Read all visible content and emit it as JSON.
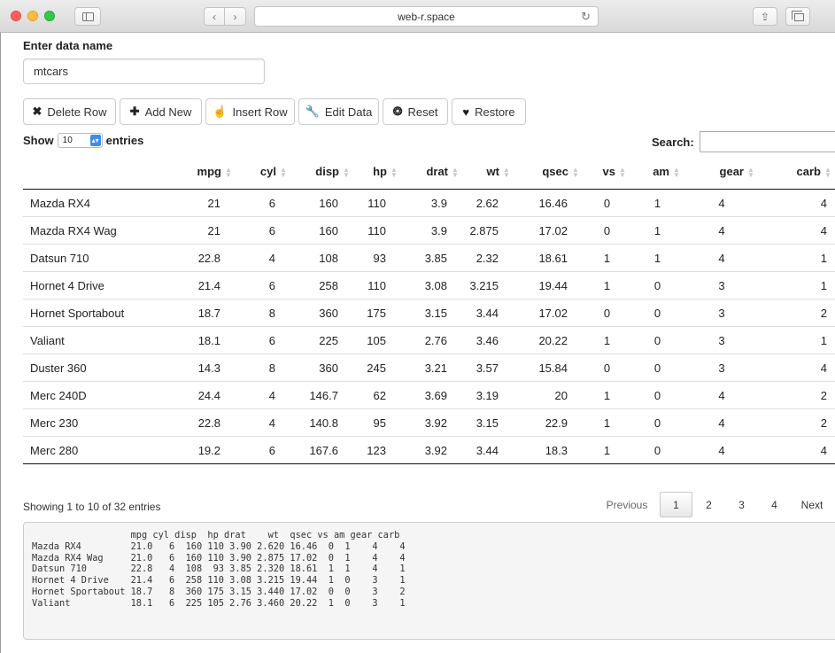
{
  "browser": {
    "address": "web-r.space",
    "back_icon": "chevron-left-icon",
    "forward_icon": "chevron-right-icon"
  },
  "form": {
    "label": "Enter data name",
    "value": "mtcars"
  },
  "toolbar": {
    "buttons": [
      {
        "label": "Delete Row",
        "icon": "✖"
      },
      {
        "label": "Add New",
        "icon": "✚"
      },
      {
        "label": "Insert Row",
        "icon": "☝"
      },
      {
        "label": "Edit Data",
        "icon": "🔧"
      },
      {
        "label": "Reset",
        "icon": "❂"
      },
      {
        "label": "Restore",
        "icon": "♥"
      }
    ]
  },
  "table": {
    "show_label": "Show",
    "entries_label": "entries",
    "page_length": "10",
    "search_label": "Search:",
    "search_value": "",
    "columns": [
      "",
      "mpg",
      "cyl",
      "disp",
      "hp",
      "drat",
      "wt",
      "qsec",
      "vs",
      "am",
      "gear",
      "carb"
    ],
    "rows": [
      [
        "Mazda RX4",
        "21",
        "6",
        "160",
        "110",
        "3.9",
        "2.62",
        "16.46",
        "0",
        "1",
        "4",
        "4"
      ],
      [
        "Mazda RX4 Wag",
        "21",
        "6",
        "160",
        "110",
        "3.9",
        "2.875",
        "17.02",
        "0",
        "1",
        "4",
        "4"
      ],
      [
        "Datsun 710",
        "22.8",
        "4",
        "108",
        "93",
        "3.85",
        "2.32",
        "18.61",
        "1",
        "1",
        "4",
        "1"
      ],
      [
        "Hornet 4 Drive",
        "21.4",
        "6",
        "258",
        "110",
        "3.08",
        "3.215",
        "19.44",
        "1",
        "0",
        "3",
        "1"
      ],
      [
        "Hornet Sportabout",
        "18.7",
        "8",
        "360",
        "175",
        "3.15",
        "3.44",
        "17.02",
        "0",
        "0",
        "3",
        "2"
      ],
      [
        "Valiant",
        "18.1",
        "6",
        "225",
        "105",
        "2.76",
        "3.46",
        "20.22",
        "1",
        "0",
        "3",
        "1"
      ],
      [
        "Duster 360",
        "14.3",
        "8",
        "360",
        "245",
        "3.21",
        "3.57",
        "15.84",
        "0",
        "0",
        "3",
        "4"
      ],
      [
        "Merc 240D",
        "24.4",
        "4",
        "146.7",
        "62",
        "3.69",
        "3.19",
        "20",
        "1",
        "0",
        "4",
        "2"
      ],
      [
        "Merc 230",
        "22.8",
        "4",
        "140.8",
        "95",
        "3.92",
        "3.15",
        "22.9",
        "1",
        "0",
        "4",
        "2"
      ],
      [
        "Merc 280",
        "19.2",
        "6",
        "167.6",
        "123",
        "3.92",
        "3.44",
        "18.3",
        "1",
        "0",
        "4",
        "4"
      ]
    ],
    "info": "Showing 1 to 10 of 32 entries",
    "pagination": {
      "previous": "Previous",
      "pages": [
        "1",
        "2",
        "3",
        "4"
      ],
      "current": "1",
      "next": "Next"
    }
  },
  "console": {
    "output": "                  mpg cyl disp  hp drat    wt  qsec vs am gear carb\nMazda RX4         21.0   6  160 110 3.90 2.620 16.46  0  1    4    4\nMazda RX4 Wag     21.0   6  160 110 3.90 2.875 17.02  0  1    4    4\nDatsun 710        22.8   4  108  93 3.85 2.320 18.61  1  1    4    1\nHornet 4 Drive    21.4   6  258 110 3.08 3.215 19.44  1  0    3    1\nHornet Sportabout 18.7   8  360 175 3.15 3.440 17.02  0  0    3    2\nValiant           18.1   6  225 105 2.76 3.460 20.22  1  0    3    1"
  }
}
